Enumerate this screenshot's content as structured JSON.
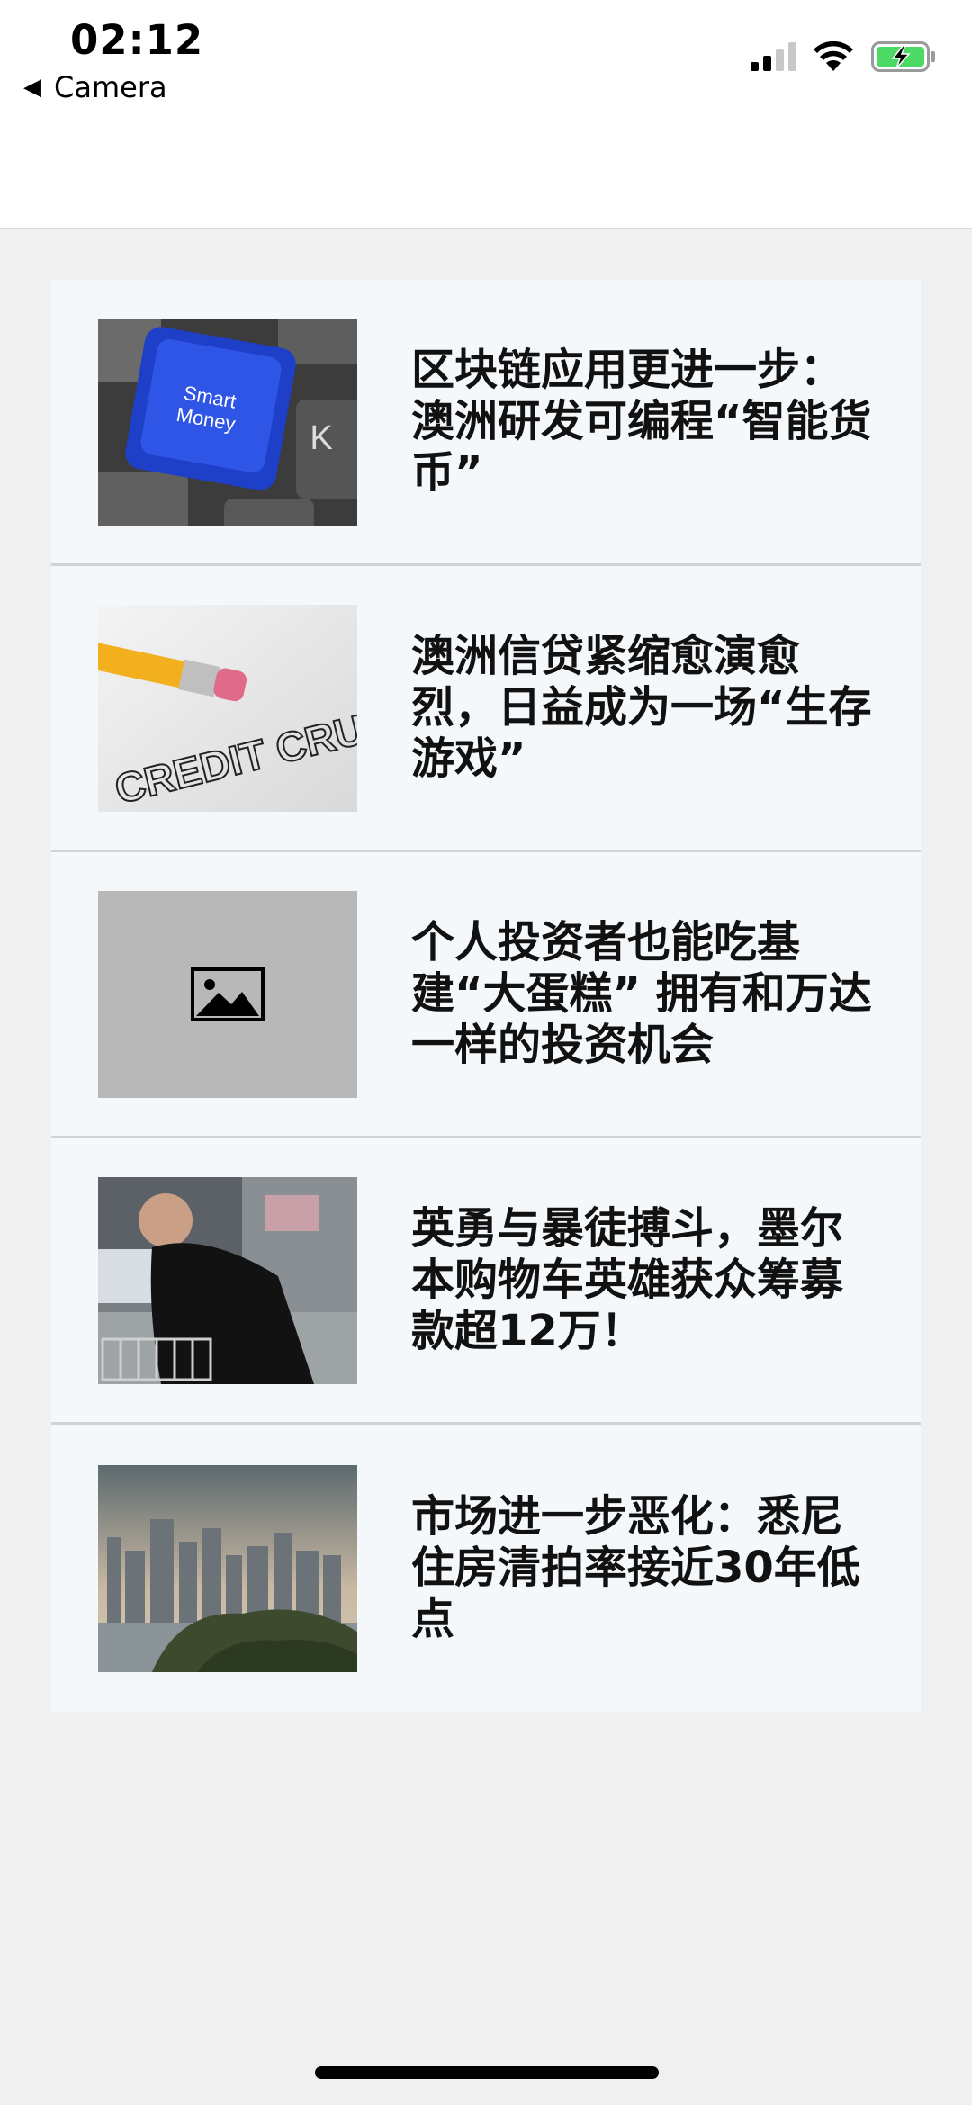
{
  "status_bar": {
    "time": "02:12",
    "back_label": "Camera"
  },
  "articles": [
    {
      "headline": "区块链应用更进一步：澳洲研发可编程“智能货币”",
      "thumb_icon": "smart-money-key-photo"
    },
    {
      "headline": "澳洲信贷紧缩愈演愈烈，日益成为一场“生存游戏”",
      "thumb_icon": "credit-crunch-pencil-photo"
    },
    {
      "headline": "个人投资者也能吃基建“大蛋糕” 拥有和万达一样的投资机会",
      "thumb_icon": "image-placeholder-icon"
    },
    {
      "headline": "英勇与暴徒搏斗，墨尔本购物车英雄获众筹募款超12万！",
      "thumb_icon": "trolley-man-photo"
    },
    {
      "headline": "市场进一步恶化：悉尼住房清拍率接近30年低点",
      "thumb_icon": "sydney-skyline-photo"
    }
  ],
  "thumb_texts": {
    "key_text": "Smart Money",
    "key_letter": "K",
    "credit_text": "CREDIT CRUNCH"
  }
}
